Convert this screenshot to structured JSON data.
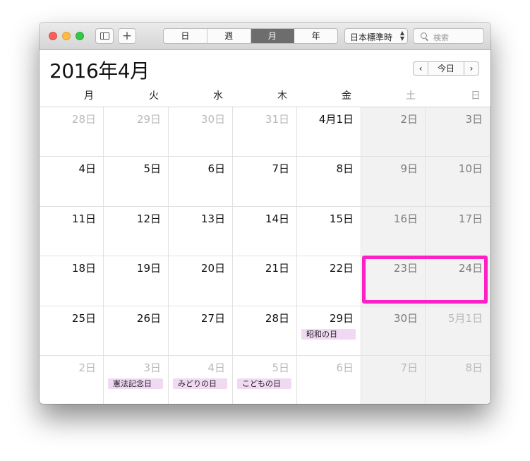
{
  "toolbar": {
    "views": [
      {
        "label": "日",
        "active": false
      },
      {
        "label": "週",
        "active": false
      },
      {
        "label": "月",
        "active": true
      },
      {
        "label": "年",
        "active": false
      }
    ],
    "timezone": "日本標準時",
    "search_placeholder": "検索",
    "add_label": "+"
  },
  "header": {
    "title": "2016年4月",
    "prev": "‹",
    "today": "今日",
    "next": "›"
  },
  "weekdays": [
    "月",
    "火",
    "水",
    "木",
    "金",
    "土",
    "日"
  ],
  "weeks": [
    [
      {
        "label": "28日",
        "other": true
      },
      {
        "label": "29日",
        "other": true
      },
      {
        "label": "30日",
        "other": true
      },
      {
        "label": "31日",
        "other": true
      },
      {
        "label": "4月1日",
        "other": false
      },
      {
        "label": "2日",
        "other": false
      },
      {
        "label": "3日",
        "other": false
      }
    ],
    [
      {
        "label": "4日",
        "other": false
      },
      {
        "label": "5日",
        "other": false
      },
      {
        "label": "6日",
        "other": false
      },
      {
        "label": "7日",
        "other": false
      },
      {
        "label": "8日",
        "other": false
      },
      {
        "label": "9日",
        "other": false
      },
      {
        "label": "10日",
        "other": false
      }
    ],
    [
      {
        "label": "11日",
        "other": false
      },
      {
        "label": "12日",
        "other": false
      },
      {
        "label": "13日",
        "other": false
      },
      {
        "label": "14日",
        "other": false
      },
      {
        "label": "15日",
        "other": false
      },
      {
        "label": "16日",
        "other": false
      },
      {
        "label": "17日",
        "other": false
      }
    ],
    [
      {
        "label": "18日",
        "other": false
      },
      {
        "label": "19日",
        "other": false
      },
      {
        "label": "20日",
        "other": false
      },
      {
        "label": "21日",
        "other": false
      },
      {
        "label": "22日",
        "other": false
      },
      {
        "label": "23日",
        "other": false
      },
      {
        "label": "24日",
        "other": false
      }
    ],
    [
      {
        "label": "25日",
        "other": false
      },
      {
        "label": "26日",
        "other": false
      },
      {
        "label": "27日",
        "other": false
      },
      {
        "label": "28日",
        "other": false
      },
      {
        "label": "29日",
        "other": false,
        "event": "昭和の日"
      },
      {
        "label": "30日",
        "other": false
      },
      {
        "label": "5月1日",
        "other": true
      }
    ],
    [
      {
        "label": "2日",
        "other": true
      },
      {
        "label": "3日",
        "other": true,
        "event": "憲法記念日"
      },
      {
        "label": "4日",
        "other": true,
        "event": "みどりの日"
      },
      {
        "label": "5日",
        "other": true,
        "event": "こどもの日"
      },
      {
        "label": "6日",
        "other": true
      },
      {
        "label": "7日",
        "other": true
      },
      {
        "label": "8日",
        "other": true
      }
    ]
  ],
  "colors": {
    "event_bg": "#f1d9f4",
    "highlight": "#ff1fc6",
    "weekend_bg": "#f2f2f2"
  }
}
